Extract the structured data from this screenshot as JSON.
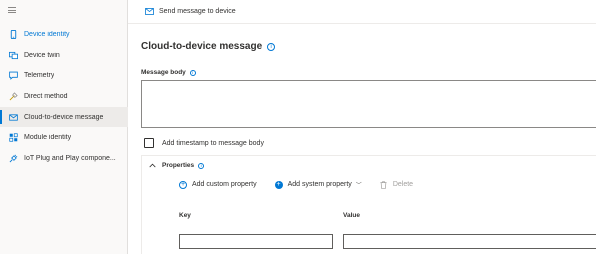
{
  "sidebar": {
    "items": [
      {
        "label": "Device identity",
        "icon": "phone-icon"
      },
      {
        "label": "Device twin",
        "icon": "twin-icon"
      },
      {
        "label": "Telemetry",
        "icon": "chat-icon"
      },
      {
        "label": "Direct method",
        "icon": "method-icon"
      },
      {
        "label": "Cloud-to-device message",
        "icon": "mail-icon"
      },
      {
        "label": "Module identity",
        "icon": "modules-icon"
      },
      {
        "label": "IoT Plug and Play compone...",
        "icon": "plug-icon"
      }
    ],
    "active_index": 4
  },
  "toolbar": {
    "send_label": "Send message to device"
  },
  "main": {
    "title": "Cloud-to-device message",
    "message_body_label": "Message body",
    "message_body_value": "",
    "timestamp_label": "Add timestamp to message body",
    "timestamp_checked": false,
    "properties": {
      "title": "Properties",
      "expanded": true,
      "add_custom_label": "Add custom property",
      "add_system_label": "Add system property",
      "delete_label": "Delete",
      "key_header": "Key",
      "value_header": "Value",
      "key_value": "",
      "value_value": ""
    }
  },
  "colors": {
    "accent": "#0078d4",
    "sidebar_bg": "#faf9f8",
    "active_bg": "#edebe9",
    "text": "#323130",
    "disabled_text": "#a19f9d"
  }
}
